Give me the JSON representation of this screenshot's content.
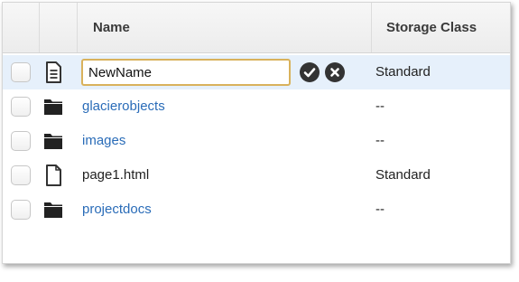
{
  "table": {
    "columns": {
      "name": "Name",
      "storage_class": "Storage Class"
    },
    "rename": {
      "value": "NewName",
      "original_storage": "Standard",
      "confirm_icon": "checkmark-circle-icon",
      "cancel_icon": "x-circle-icon"
    },
    "rows": [
      {
        "name": "glacierobjects",
        "storage": "--",
        "type": "folder",
        "icon": "folder-icon"
      },
      {
        "name": "images",
        "storage": "--",
        "type": "folder",
        "icon": "folder-icon"
      },
      {
        "name": "page1.html",
        "storage": "Standard",
        "type": "file",
        "icon": "file-icon"
      },
      {
        "name": "projectdocs",
        "storage": "--",
        "type": "folder",
        "icon": "folder-icon"
      }
    ]
  },
  "colors": {
    "link": "#2a6cb8",
    "selected_row": "#e6f0fb",
    "input_focus_border": "#d9b25c"
  }
}
